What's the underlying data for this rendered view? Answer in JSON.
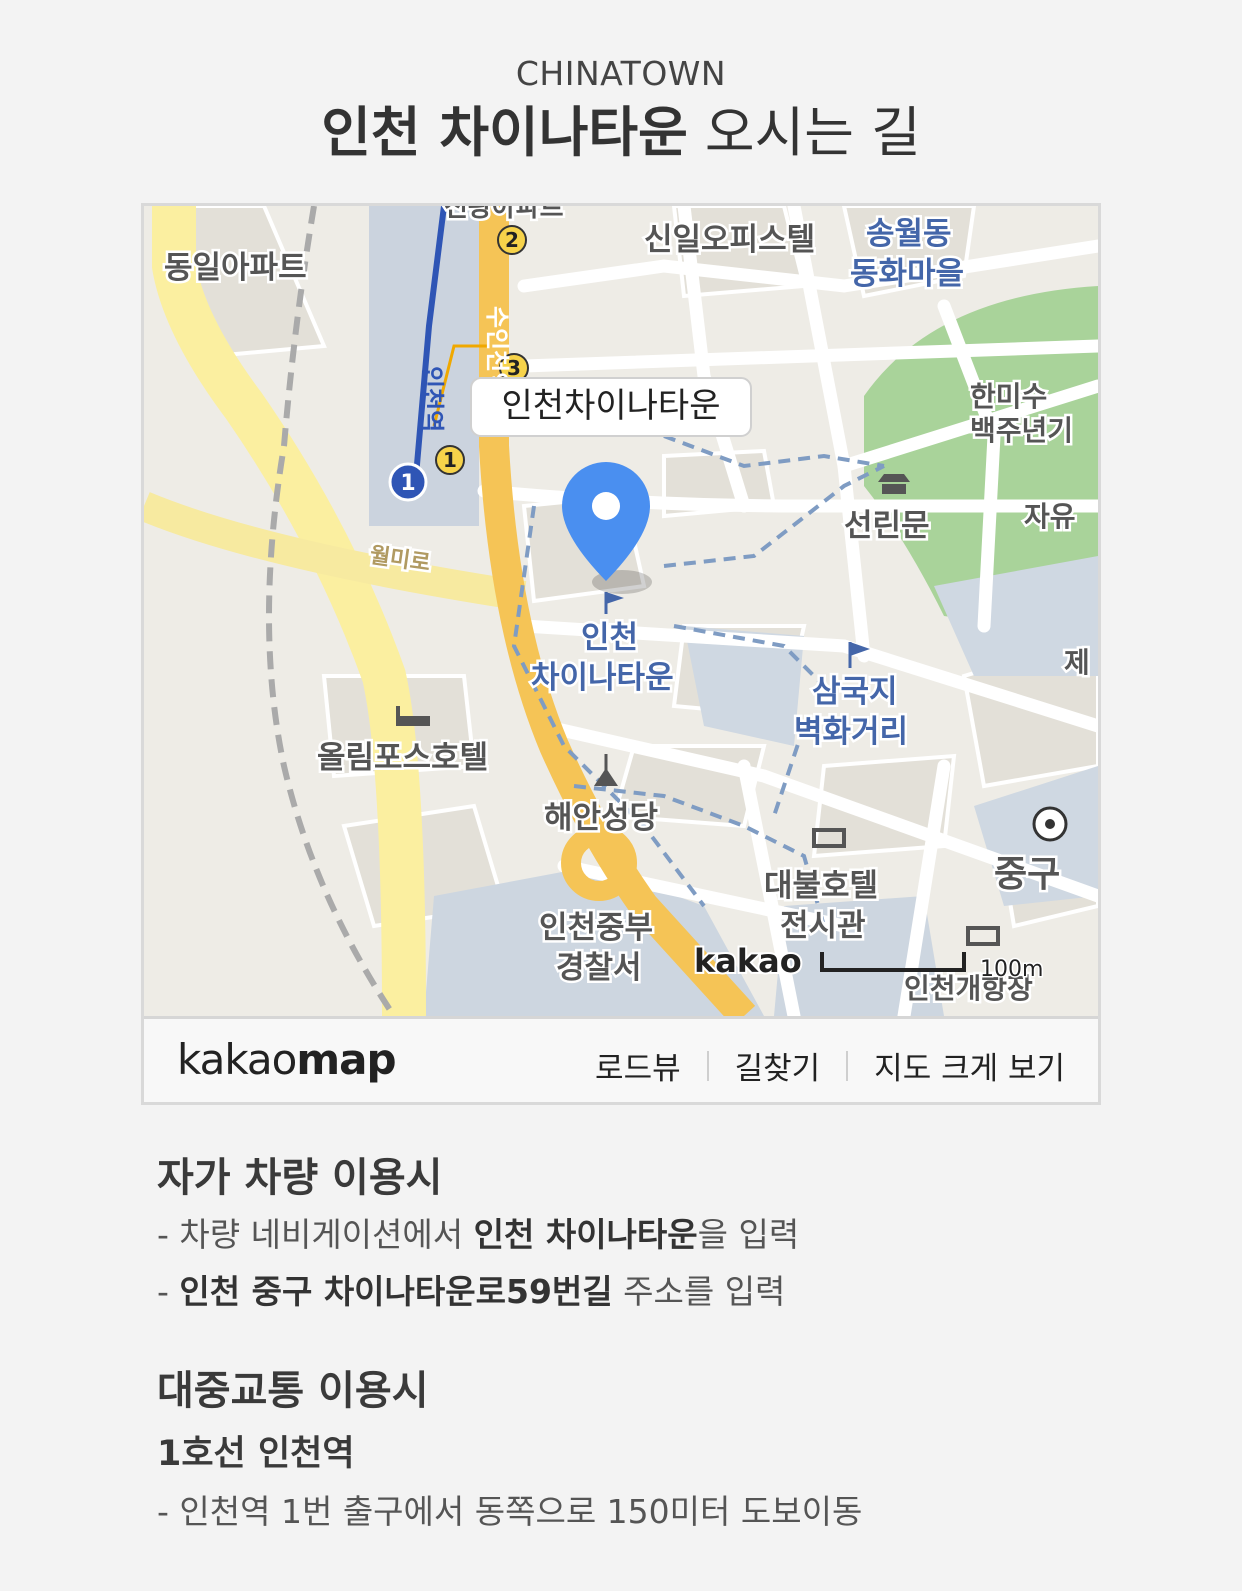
{
  "header": {
    "subtitle": "CHINATOWN",
    "title_bold": "인천 차이나타운",
    "title_rest": " 오시는 길"
  },
  "map": {
    "marker_label": "인천차이나타운",
    "watermark": "kakao",
    "scale": "100m",
    "place_labels": {
      "dongil_apt": "동일아파트",
      "sinil_office": "신일오피스텔",
      "songwol_line1": "송월동",
      "songwol_line2": "동화마을",
      "hanmi_line1": "한미수",
      "hanmi_line2": "백주년기",
      "jayu": "자유",
      "seonrinmun": "선린문",
      "chinatown_line1": "인천",
      "chinatown_line2": "차이나타운",
      "samgukji_line1": "삼국지",
      "samgukji_line2": "벽화거리",
      "olympos": "올림포스호텔",
      "haean": "해안성당",
      "daebul_line1": "대불호텔",
      "daebul_line2": "전시관",
      "police_line1": "인천중부",
      "police_line2": "경찰서",
      "junggu": "중구",
      "port": "인천개항장",
      "wolmiro": "월미로",
      "incheon_station": "인천역",
      "suin_station": "수인천역",
      "top_apt": "신광아파트",
      "je": "제"
    },
    "exit_numbers": [
      "1",
      "2",
      "3"
    ],
    "subway_line_badge": "1"
  },
  "map_footer": {
    "logo_light": "kakao",
    "logo_bold": "map",
    "links": [
      "로드뷰",
      "길찾기",
      "지도 크게 보기"
    ]
  },
  "car": {
    "title": "자가 차량 이용시",
    "line1_prefix": "- 차량 네비게이션에서 ",
    "line1_bold": "인천 차이나타운",
    "line1_suffix": "을 입력",
    "line2_prefix": "- ",
    "line2_bold": "인천 중구 차이나타운로59번길",
    "line2_suffix": " 주소를 입력"
  },
  "transit": {
    "title": "대중교통 이용시",
    "subtitle": "1호선 인천역",
    "line1": "- 인천역 1번 출구에서 동쪽으로 150미터 도보이동"
  },
  "colors": {
    "background": "#f3f3f3",
    "marker_blue": "#4a8ff0",
    "major_road": "#f5c456",
    "park_green": "#a9d39a",
    "subway_blue": "#2f55b5",
    "label_blue": "#4466a9"
  }
}
